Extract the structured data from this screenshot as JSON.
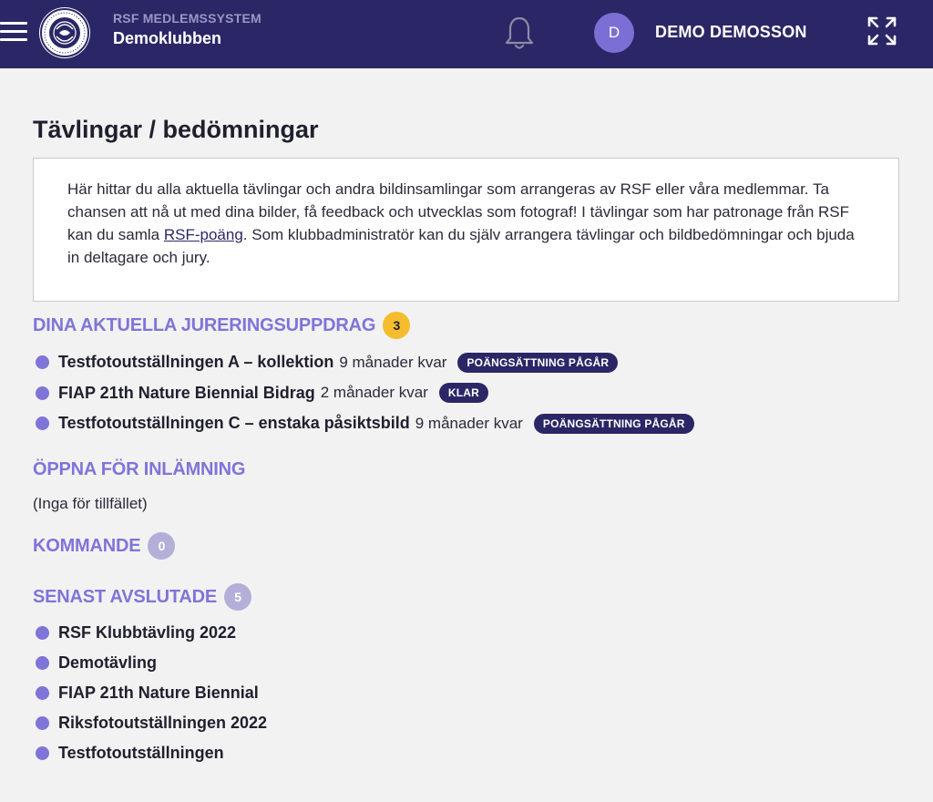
{
  "header": {
    "system_name": "RSF MEDLEMSSYSTEM",
    "club_name": "Demoklubben",
    "logo_text": "RIKSFÖRBUNDET SVENSK FOTOGRAFI · FIAP",
    "avatar_initial": "D",
    "user_name": "DEMO DEMOSSON",
    "icons": [
      "menu-icon",
      "bell-icon",
      "expand-icon"
    ]
  },
  "page": {
    "title": "Tävlingar / bedömningar",
    "intro_before_link": "Här hittar du alla aktuella tävlingar och andra bildinsamlingar som arrangeras av RSF eller våra medlemmar. Ta chansen att nå ut med dina bilder, få feedback och utvecklas som fotograf! I tävlingar som har patronage från RSF kan du samla ",
    "intro_link": "RSF-poäng",
    "intro_after_link": ". Som klubbadministratör kan du själv arrangera tävlingar och bildbedömningar och bjuda in deltagare och jury."
  },
  "jury": {
    "heading": "DINA AKTUELLA JURERINGSUPPDRAG",
    "count": "3",
    "items": [
      {
        "title": "Testfotoutställningen A – kollektion",
        "remaining": "9 månader kvar",
        "status": "POÄNGSÄTTNING PÅGÅR"
      },
      {
        "title": "FIAP 21th Nature Biennial Bidrag",
        "remaining": "2 månader kvar",
        "status": "KLAR"
      },
      {
        "title": "Testfotoutställningen C – enstaka påsiktsbild",
        "remaining": "9 månader kvar",
        "status": "POÄNGSÄTTNING PÅGÅR"
      }
    ]
  },
  "open": {
    "heading": "ÖPPNA FÖR INLÄMNING",
    "empty_text": "(Inga för tillfället)"
  },
  "upcoming": {
    "heading": "KOMMANDE",
    "count": "0"
  },
  "finished": {
    "heading": "SENAST AVSLUTADE",
    "count": "5",
    "items": [
      {
        "title": "RSF Klubbtävling 2022"
      },
      {
        "title": "Demotävling"
      },
      {
        "title": "FIAP 21th Nature Biennial"
      },
      {
        "title": "Riksfotoutställningen 2022"
      },
      {
        "title": "Testfotoutställningen"
      }
    ]
  },
  "colors": {
    "header_bg": "#2b2766",
    "accent": "#7f74d8",
    "badge_yellow": "#f5bd2e",
    "badge_grey": "#b3afd8",
    "status_pill": "#2b2766"
  }
}
